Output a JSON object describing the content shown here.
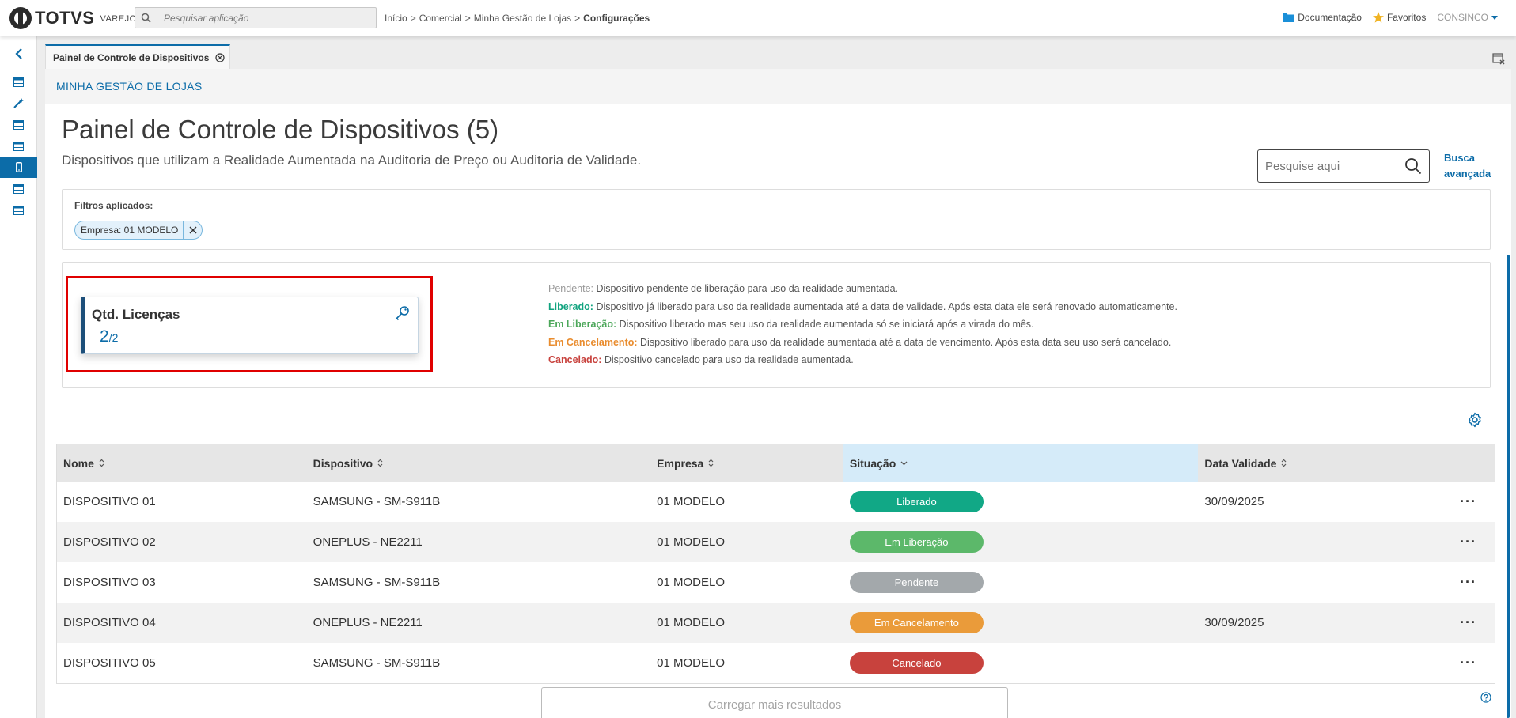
{
  "brand": {
    "name": "TOTVS",
    "product": "VAREJO"
  },
  "app_search": {
    "placeholder": "Pesquisar aplicação"
  },
  "breadcrumb": {
    "items": [
      "Início",
      ">",
      "Comercial",
      ">",
      "Minha Gestão de Lojas",
      ">"
    ],
    "current": "Configurações"
  },
  "top_links": {
    "docs": "Documentação",
    "favorites": "Favoritos",
    "user": "CONSINCO"
  },
  "colors": {
    "accent": "#0c6ca8",
    "liberado": "#11a37f",
    "em_liberacao": "#5cb86a",
    "pendente": "#a3a8ab",
    "em_cancelamento": "#ea9b3a",
    "cancelado": "#c8423d",
    "highlight": "#e00000"
  },
  "tab": {
    "label": "Painel de Controle de Dispositivos"
  },
  "section": {
    "label": "MINHA GESTÃO DE LOJAS"
  },
  "page": {
    "title": "Painel de Controle de Dispositivos (5)",
    "subtitle": "Dispositivos que utilizam a Realidade Aumentada na Auditoria de Preço ou Auditoria de Validade.",
    "search_placeholder": "Pesquise aqui",
    "advanced_search": "Busca avançada"
  },
  "filters": {
    "label": "Filtros aplicados:",
    "chip": "Empresa: 01 MODELO"
  },
  "license": {
    "title": "Qtd. Licenças",
    "used": "2",
    "total": "/2"
  },
  "legend": [
    {
      "label": "Pendente:",
      "text": "Dispositivo pendente de liberação para uso da realidade aumentada."
    },
    {
      "label": "Liberado:",
      "text": "Dispositivo já liberado para uso da realidade aumentada até a data de validade. Após esta data ele será renovado automaticamente."
    },
    {
      "label": "Em Liberação:",
      "text": "Dispositivo liberado mas seu uso da realidade aumentada só se iniciará após a virada do mês."
    },
    {
      "label": "Em Cancelamento:",
      "text": "Dispositivo liberado para uso da realidade aumentada até a data de vencimento. Após esta data seu uso será cancelado."
    },
    {
      "label": "Cancelado:",
      "text": "Dispositivo cancelado para uso da realidade aumentada."
    }
  ],
  "table": {
    "headers": [
      "Nome",
      "Dispositivo",
      "Empresa",
      "Situação",
      "Data Validade"
    ],
    "rows": [
      {
        "nome": "DISPOSITIVO 01",
        "dispositivo": "SAMSUNG - SM-S911B",
        "empresa": "01 MODELO",
        "situacao": "Liberado",
        "validade": "30/09/2025"
      },
      {
        "nome": "DISPOSITIVO 02",
        "dispositivo": "ONEPLUS - NE2211",
        "empresa": "01 MODELO",
        "situacao": "Em Liberação",
        "validade": ""
      },
      {
        "nome": "DISPOSITIVO 03",
        "dispositivo": "SAMSUNG - SM-S911B",
        "empresa": "01 MODELO",
        "situacao": "Pendente",
        "validade": ""
      },
      {
        "nome": "DISPOSITIVO 04",
        "dispositivo": "ONEPLUS - NE2211",
        "empresa": "01 MODELO",
        "situacao": "Em Cancelamento",
        "validade": "30/09/2025"
      },
      {
        "nome": "DISPOSITIVO 05",
        "dispositivo": "SAMSUNG - SM-S911B",
        "empresa": "01 MODELO",
        "situacao": "Cancelado",
        "validade": ""
      }
    ],
    "more_glyph": "···"
  },
  "load_more": "Carregar mais resultados"
}
